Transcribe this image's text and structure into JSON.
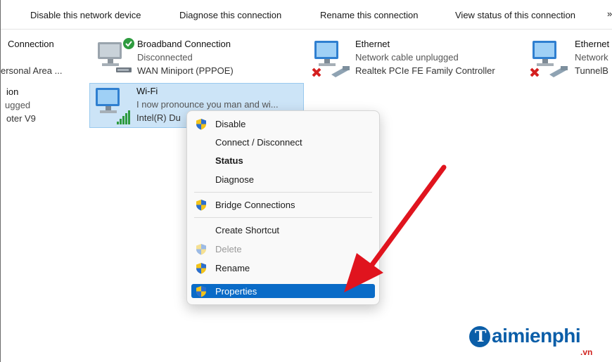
{
  "command_bar": {
    "disable": "Disable this network device",
    "diagnose": "Diagnose this connection",
    "rename": "Rename this connection",
    "view_status": "View status of this connection",
    "more": "»"
  },
  "adapters": {
    "conn_left": {
      "name": "Connection",
      "line2": "",
      "line3": "ersonal Area ..."
    },
    "conn_left2": {
      "name": "ion",
      "line2": "ugged",
      "line3": "oter V9"
    },
    "broadband": {
      "name": "Broadband Connection",
      "status": "Disconnected",
      "device": "WAN Miniport (PPPOE)"
    },
    "ethernet1": {
      "name": "Ethernet",
      "status": "Network cable unplugged",
      "device": "Realtek PCIe FE Family Controller"
    },
    "ethernet2": {
      "name": "Ethernet",
      "status": "Network",
      "device": "TunnelB"
    },
    "wifi": {
      "name": "Wi-Fi",
      "status": "I now pronounce you man and wi...",
      "device": "Intel(R) Du"
    }
  },
  "context_menu": {
    "disable": "Disable",
    "connect": "Connect / Disconnect",
    "status": "Status",
    "diagnose": "Diagnose",
    "bridge": "Bridge Connections",
    "shortcut": "Create Shortcut",
    "delete": "Delete",
    "rename": "Rename",
    "properties": "Properties"
  },
  "colors": {
    "selection": "#cce4f7",
    "highlight": "#0a6bc7",
    "arrow": "#e0141e",
    "logo": "#0b5ea8"
  },
  "watermark": {
    "letter": "T",
    "word": "aimienphi",
    "tld": ".vn"
  }
}
